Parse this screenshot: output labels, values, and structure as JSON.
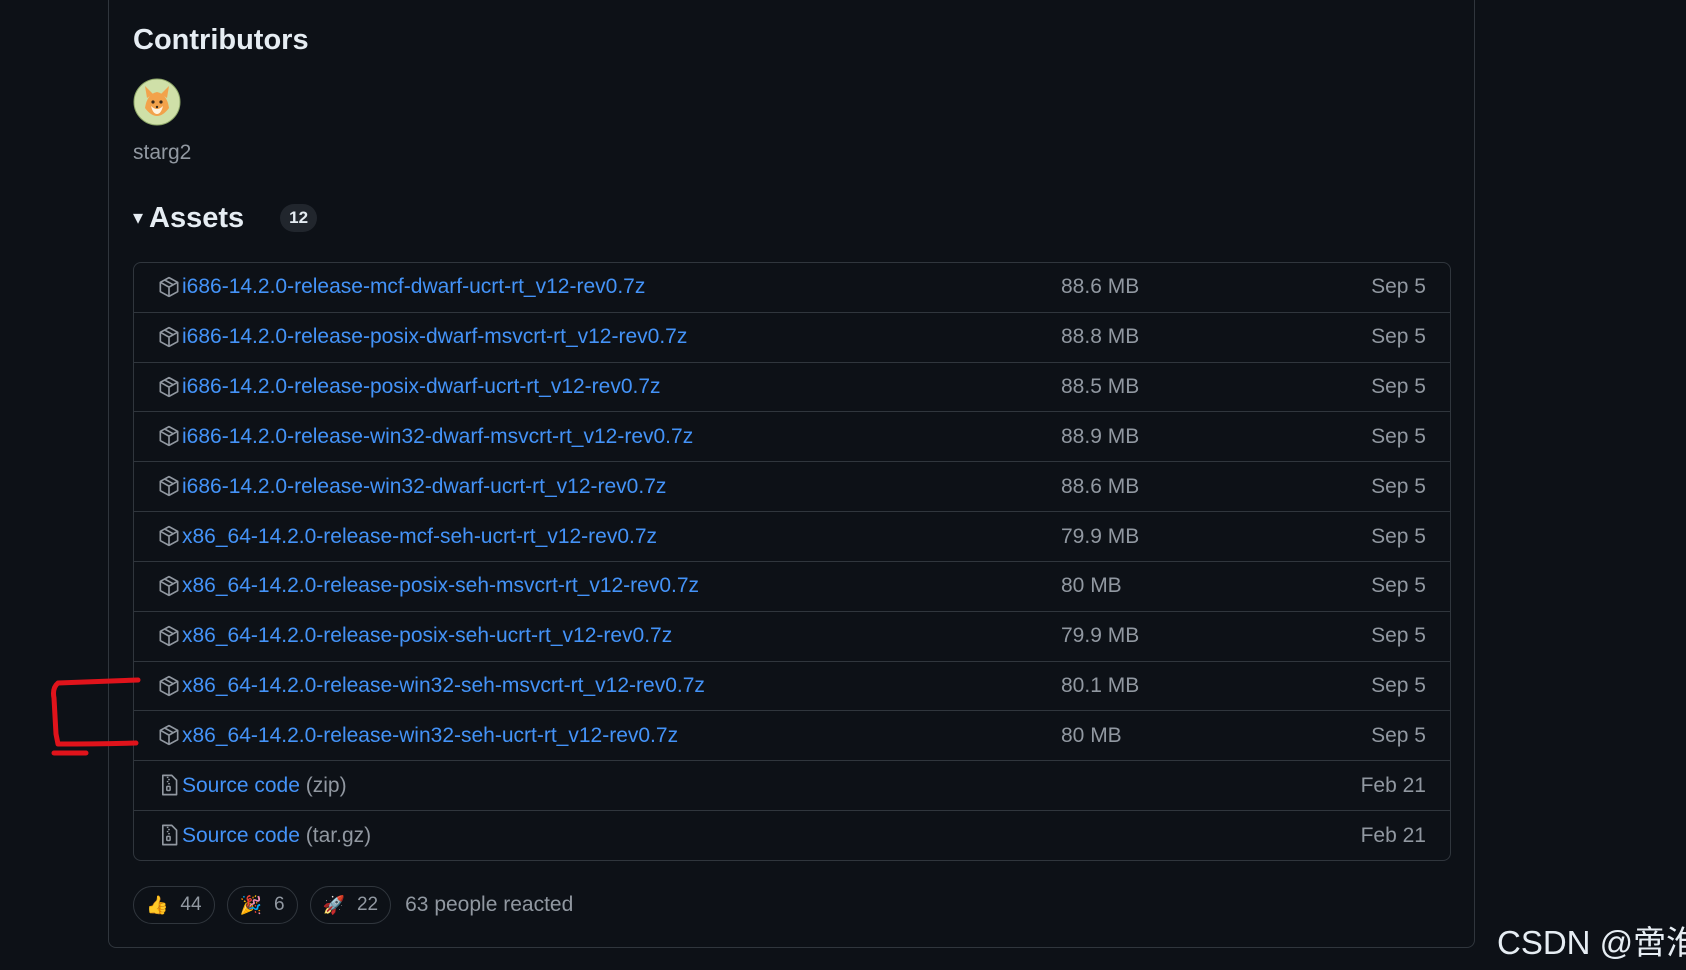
{
  "contributors": {
    "title": "Contributors",
    "users": [
      {
        "name": "starg2"
      }
    ]
  },
  "assets": {
    "toggle_glyph": "▾",
    "title": "Assets",
    "count": "12",
    "rows": [
      {
        "name": "i686-14.2.0-release-mcf-dwarf-ucrt-rt_v12-rev0.7z",
        "size": "88.6 MB",
        "date": "Sep 5",
        "icon": "package-icon"
      },
      {
        "name": "i686-14.2.0-release-posix-dwarf-msvcrt-rt_v12-rev0.7z",
        "size": "88.8 MB",
        "date": "Sep 5",
        "icon": "package-icon"
      },
      {
        "name": "i686-14.2.0-release-posix-dwarf-ucrt-rt_v12-rev0.7z",
        "size": "88.5 MB",
        "date": "Sep 5",
        "icon": "package-icon"
      },
      {
        "name": "i686-14.2.0-release-win32-dwarf-msvcrt-rt_v12-rev0.7z",
        "size": "88.9 MB",
        "date": "Sep 5",
        "icon": "package-icon"
      },
      {
        "name": "i686-14.2.0-release-win32-dwarf-ucrt-rt_v12-rev0.7z",
        "size": "88.6 MB",
        "date": "Sep 5",
        "icon": "package-icon"
      },
      {
        "name": "x86_64-14.2.0-release-mcf-seh-ucrt-rt_v12-rev0.7z",
        "size": "79.9 MB",
        "date": "Sep 5",
        "icon": "package-icon"
      },
      {
        "name": "x86_64-14.2.0-release-posix-seh-msvcrt-rt_v12-rev0.7z",
        "size": "80 MB",
        "date": "Sep 5",
        "icon": "package-icon"
      },
      {
        "name": "x86_64-14.2.0-release-posix-seh-ucrt-rt_v12-rev0.7z",
        "size": "79.9 MB",
        "date": "Sep 5",
        "icon": "package-icon"
      },
      {
        "name": "x86_64-14.2.0-release-win32-seh-msvcrt-rt_v12-rev0.7z",
        "size": "80.1 MB",
        "date": "Sep 5",
        "icon": "package-icon"
      },
      {
        "name": "x86_64-14.2.0-release-win32-seh-ucrt-rt_v12-rev0.7z",
        "size": "80 MB",
        "date": "Sep 5",
        "icon": "package-icon"
      },
      {
        "name": "Source code",
        "suffix": "(zip)",
        "size": "",
        "date": "Feb 21",
        "icon": "file-zip-icon"
      },
      {
        "name": "Source code",
        "suffix": "(tar.gz)",
        "size": "",
        "date": "Feb 21",
        "icon": "file-zip-icon"
      }
    ]
  },
  "reactions": {
    "items": [
      {
        "emoji": "👍",
        "count": "44",
        "icon": "thumbs-up-icon"
      },
      {
        "emoji": "🎉",
        "count": "6",
        "icon": "tada-icon"
      },
      {
        "emoji": "🚀",
        "count": "22",
        "icon": "rocket-icon"
      }
    ],
    "summary": "63 people reacted"
  },
  "watermark": "CSDN @啻淮",
  "colors": {
    "background": "#0d1117",
    "border": "#30363d",
    "link": "#4493f8",
    "muted": "#9198a1",
    "annotation": "#e0131b"
  }
}
